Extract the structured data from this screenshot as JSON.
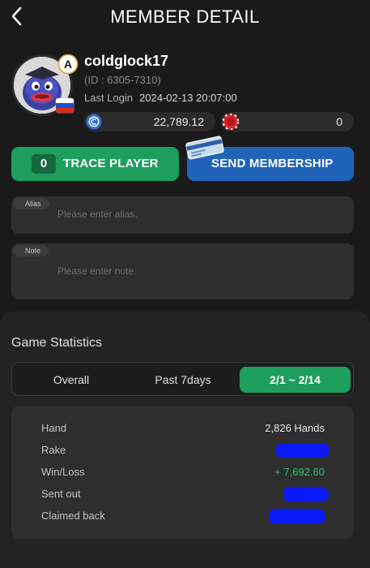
{
  "header": {
    "title": "MEMBER DETAIL",
    "back_icon": "chevron-left-icon"
  },
  "profile": {
    "grade_badge": "A",
    "username": "coldglock17",
    "id_text": "(ID : 6305-7310)",
    "last_login_label": "Last Login",
    "last_login_value": "2024-02-13 20:07:00",
    "flag_icon": "russia-flag-icon",
    "balances": [
      {
        "icon": "blue-chip-icon",
        "amount": "22,789.12"
      },
      {
        "icon": "red-chip-icon",
        "amount": "0"
      }
    ]
  },
  "actions": {
    "trace_count": "0",
    "trace_label": "TRACE PLAYER",
    "membership_label": "SEND MEMBERSHIP",
    "membership_icon": "membership-card-icon"
  },
  "fields": {
    "alias": {
      "tag": "Alias",
      "placeholder": "Please enter alias."
    },
    "note": {
      "tag": "Note",
      "placeholder": "Please enter note."
    }
  },
  "stats": {
    "title": "Game Statistics",
    "tabs": [
      {
        "label": "Overall",
        "active": false
      },
      {
        "label": "Past 7days",
        "active": false
      },
      {
        "label": "2/1 ~ 2/14",
        "active": true
      }
    ],
    "rows": [
      {
        "label": "Hand",
        "value": "2,826 Hands",
        "redacted": false
      },
      {
        "label": "Rake",
        "value": "",
        "redacted": true
      },
      {
        "label": "Win/Loss",
        "value": "+ 7,692.60",
        "redacted": false
      },
      {
        "label": "Sent out",
        "value": "",
        "redacted": true
      },
      {
        "label": "Claimed back",
        "value": "",
        "redacted": true
      }
    ]
  },
  "colors": {
    "background": "#1a1a1a",
    "accent_green": "#1e9e5c",
    "accent_blue": "#1f64b8",
    "positive_text": "#29c07a",
    "redaction": "#0a18f6"
  }
}
